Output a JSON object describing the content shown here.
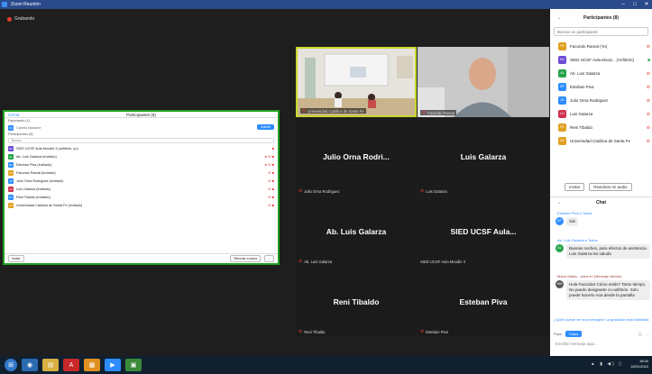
{
  "window": {
    "title": "Zoom Reunión"
  },
  "recording": {
    "label": "Grabando"
  },
  "participants_panel_small": {
    "left_label": "Cerrar",
    "title": "Participantes (9)",
    "waiting_label": "Esperando (1)",
    "waiting_name": "Camila Nardone",
    "admit_label": "Admitir",
    "section_label": "Participantes (8)",
    "search_placeholder": "Buscar",
    "rows": [
      {
        "name": "SIED UCSF Aula Moodle 3 (anfitrión, yo)",
        "color": "#6d4bd8",
        "initials": "SU"
      },
      {
        "name": "Ab. Luis Galarza (invitado)",
        "color": "#27a44a",
        "initials": "AL"
      },
      {
        "name": "Esteban Piva (invitado)",
        "color": "#2d8cff",
        "initials": "EP"
      },
      {
        "name": "Facundo Ramat (invitado)",
        "color": "#e0a020",
        "initials": "FR"
      },
      {
        "name": "Julio Orna Rodriguez (invitado)",
        "color": "#2d8cff",
        "initials": "JO"
      },
      {
        "name": "Luis Galarza (invitado)",
        "color": "#d0314f",
        "initials": "LG"
      },
      {
        "name": "Reni Tibaldo (invitado)",
        "color": "#2d8cff",
        "initials": "RT"
      },
      {
        "name": "Universidad Católica de Santa Fe (invitado)",
        "color": "#e0a020",
        "initials": "UC"
      }
    ],
    "footer_left": "Invitar",
    "footer_mid": "Silenciar a todos",
    "footer_right": "..."
  },
  "video_tiles": [
    {
      "name": "Universidad Católica de Santa Fe",
      "big": ""
    },
    {
      "name": "Facundo Ramat",
      "big": ""
    },
    {
      "name": "Julio Orna Rodriguez",
      "big": "Julio Orna Rodri..."
    },
    {
      "name": "Luis Galarza",
      "big": "Luis Galarza"
    },
    {
      "name": "Ab. Luis Galarza",
      "big": "Ab. Luis Galarza"
    },
    {
      "name": "SIED UCSF Aula Moodle 3",
      "big": "SIED UCSF Aula..."
    },
    {
      "name": "Reni Tibaldo",
      "big": "Reni Tibaldo"
    },
    {
      "name": "Esteban Piva",
      "big": "Esteban Piva"
    }
  ],
  "sidebar": {
    "title": "Participantes (8)",
    "search_placeholder": "Buscar un participante",
    "participants": [
      {
        "name": "Facundo Ramat (Yo)",
        "initials": "FR",
        "color": "#e0a020"
      },
      {
        "name": "SIED UCSF Aula Mood... (Anfitrión)",
        "initials": "SU",
        "color": "#6d4bd8"
      },
      {
        "name": "Ab. Luis Galarza",
        "initials": "AL",
        "color": "#27a44a"
      },
      {
        "name": "Esteban Piva",
        "initials": "EP",
        "color": "#2d8cff"
      },
      {
        "name": "Julio Orna Rodriguez",
        "initials": "JO",
        "color": "#2d8cff"
      },
      {
        "name": "Luis Galarza",
        "initials": "LG",
        "color": "#d0314f"
      },
      {
        "name": "Reni Tibaldo",
        "initials": "RT",
        "color": "#e0a020"
      },
      {
        "name": "Universidad Católica de Santa Fe",
        "initials": "UC",
        "color": "#e0a020"
      }
    ],
    "invite_label": "Invitar",
    "unmute_label": "Reactivar mi audio"
  },
  "chat": {
    "title": "Chat",
    "messages": [
      {
        "from": "Esteban Piva a Todos",
        "initials": "EP",
        "color": "#2d8cff",
        "text": "Siiii"
      },
      {
        "from": "Ab. Luis Galarza a Todos",
        "initials": "AL",
        "color": "#27a44a",
        "text": "Buenas noches, para efectos de asistencia Luis Galarza les saluda"
      },
      {
        "from": "María Marta... para mí (Mensaje directo)",
        "initials": "MM",
        "color": "#555555",
        "text": "Hola Facundo! Cómo estás? Tanto tiempo. No puedo designarte co-anfitrión. Solo puede hacerlo Ana desde la pantalla"
      }
    ],
    "note": "¿Quién puede ver sus mensajes? La grabación está habilitada",
    "to_label": "Para:",
    "to_value": "Todos",
    "input_placeholder": "Escribir mensaje aquí..."
  },
  "taskbar": {
    "time": "18:40",
    "date": "10/01/2022"
  }
}
